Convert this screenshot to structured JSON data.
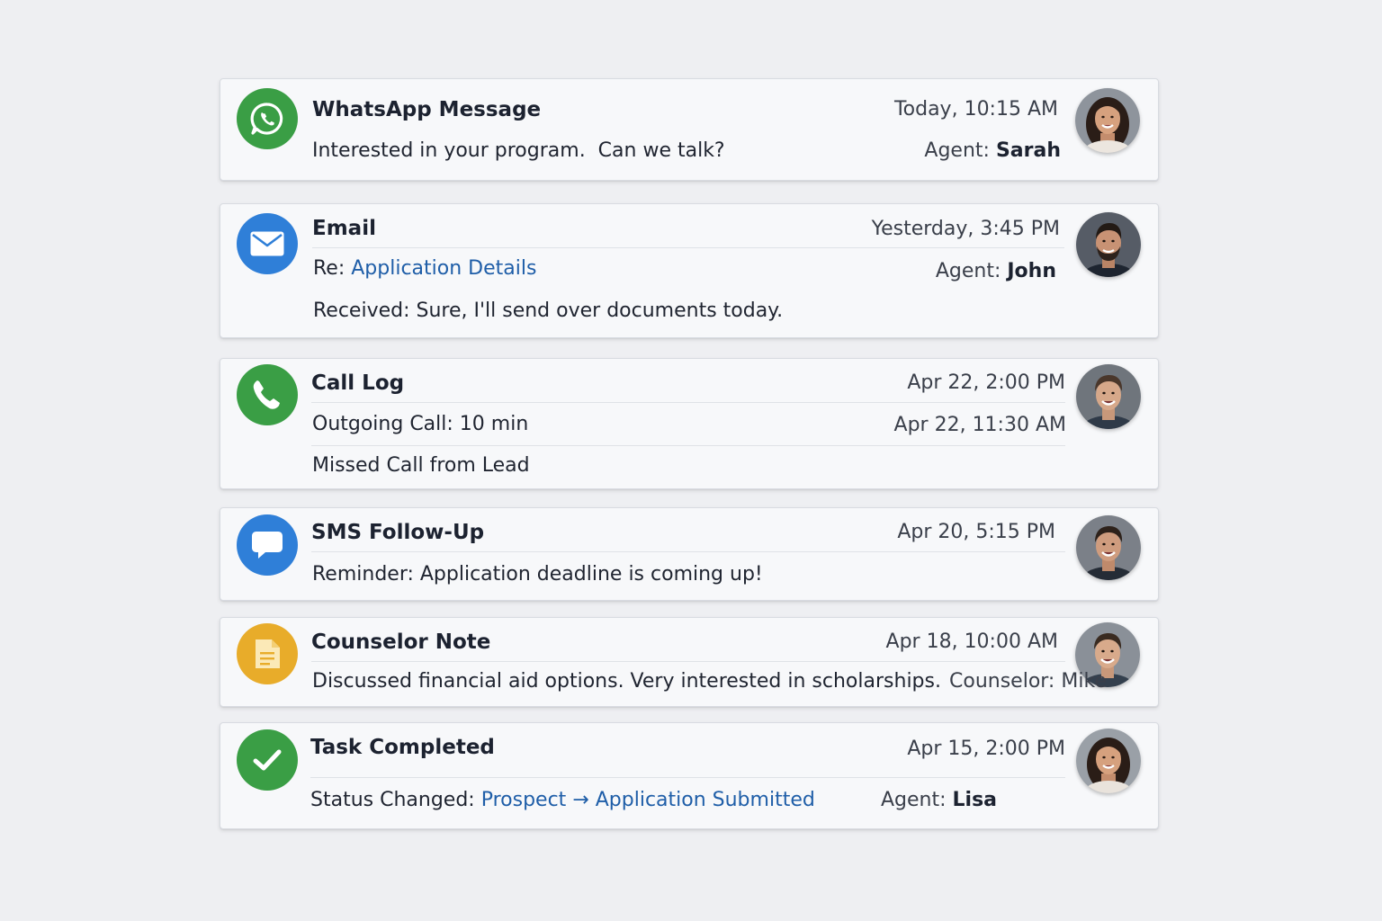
{
  "colors": {
    "whatsapp": "#3a9e45",
    "email": "#2f7fd8",
    "call": "#3a9e45",
    "sms": "#2f7fd8",
    "note": "#e8ac2a",
    "task": "#3a9e45",
    "link": "#1f5ea8"
  },
  "cards": [
    {
      "type": "whatsapp",
      "icon": "whatsapp-icon",
      "title": "WhatsApp Message",
      "timestamp": "Today, 10:15 AM",
      "body": "Interested in your program.  Can we talk?",
      "agent_label": "Agent:",
      "agent_name": "Sarah"
    },
    {
      "type": "email",
      "icon": "envelope-icon",
      "title": "Email",
      "timestamp": "Yesterday, 3:45 PM",
      "subject_prefix": "Re:",
      "subject_link": "Application Details",
      "agent_label": "Agent:",
      "agent_name": "John",
      "body": "Received: Sure, I'll send over documents today."
    },
    {
      "type": "call",
      "icon": "phone-icon",
      "title": "Call Log",
      "timestamp": "Apr 22, 2:00 PM",
      "line1": "Outgoing Call: 10 min",
      "line1_time": "Apr 22, 11:30 AM",
      "line2": "Missed Call from Lead"
    },
    {
      "type": "sms",
      "icon": "chat-bubble-icon",
      "title": "SMS Follow-Up",
      "timestamp": "Apr 20, 5:15 PM",
      "body": "Reminder: Application deadline is coming up!"
    },
    {
      "type": "note",
      "icon": "note-icon",
      "title": "Counselor Note",
      "timestamp": "Apr 18, 10:00 AM",
      "body": "Discussed financial aid options. Very interested in scholarships.",
      "agent_label": "Counselor:",
      "agent_name": "Mike"
    },
    {
      "type": "task",
      "icon": "checkmark-icon",
      "title": "Task Completed",
      "timestamp": "Apr 15, 2:00 PM",
      "status_prefix": "Status Changed:",
      "status_from": "Prospect",
      "arrow": "→",
      "status_to": "Application Submitted",
      "agent_label": "Agent:",
      "agent_name": "Lisa"
    }
  ]
}
